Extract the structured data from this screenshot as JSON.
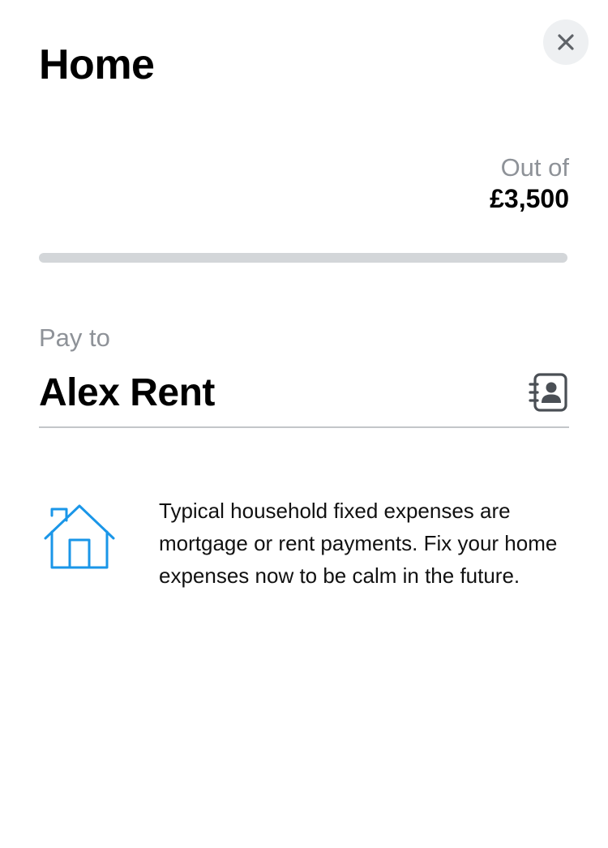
{
  "header": {
    "title": "Home",
    "close_icon": "close-icon"
  },
  "budget": {
    "label": "Out of",
    "amount": "£3,500",
    "progress_fraction": 0,
    "track_color": "#d3d6d9"
  },
  "payee": {
    "label": "Pay to",
    "name": "Alex Rent",
    "contacts_icon": "contacts-book-icon"
  },
  "info": {
    "icon": "house-icon",
    "icon_color": "#1a96e8",
    "text": "Typical household fixed expenses are mortgage or rent payments. Fix your home expenses now to be calm in the future."
  }
}
